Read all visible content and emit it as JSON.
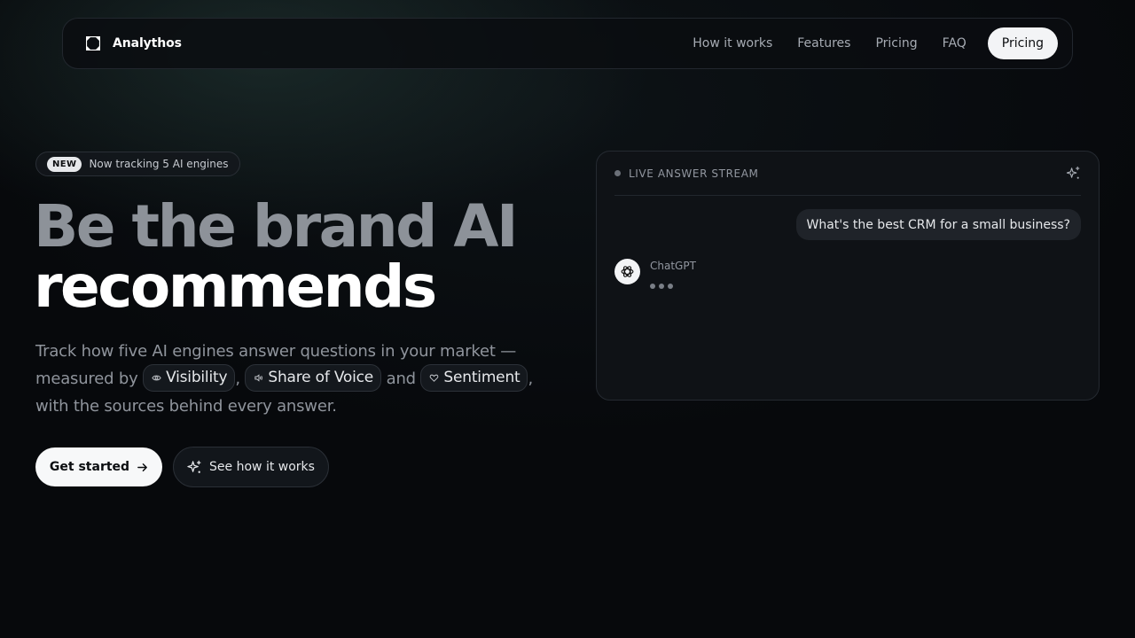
{
  "nav": {
    "brand": "Analythos",
    "links": [
      "How it works",
      "Features",
      "Pricing",
      "FAQ"
    ],
    "cta": "Pricing"
  },
  "hero": {
    "badge_pill": "NEW",
    "badge_text": "Now tracking 5 AI engines",
    "headline_line1": "Be the brand AI",
    "headline_line2": "recommends",
    "desc_part1": "Track how five AI engines answer questions in your market — measured by",
    "chip_visibility": "Visibility",
    "chip_share": "Share of Voice",
    "desc_and": "and",
    "chip_sentiment": "Sentiment",
    "desc_part2": ", with the sources behind every answer.",
    "comma": ",",
    "primary_button": "Get started",
    "secondary_button": "See how it works"
  },
  "panel": {
    "title": "LIVE ANSWER STREAM",
    "user_message": "What's the best CRM for a small business?",
    "bot_name": "ChatGPT"
  },
  "colors": {
    "background": "#07090c",
    "cta_bg": "#f3f4f6",
    "headline_muted": "#8d9299"
  },
  "icons": [
    "brand-logo-icon",
    "eye-icon",
    "speaker-icon",
    "heart-icon",
    "arrow-right-icon",
    "sparkle-icon",
    "openai-icon"
  ]
}
